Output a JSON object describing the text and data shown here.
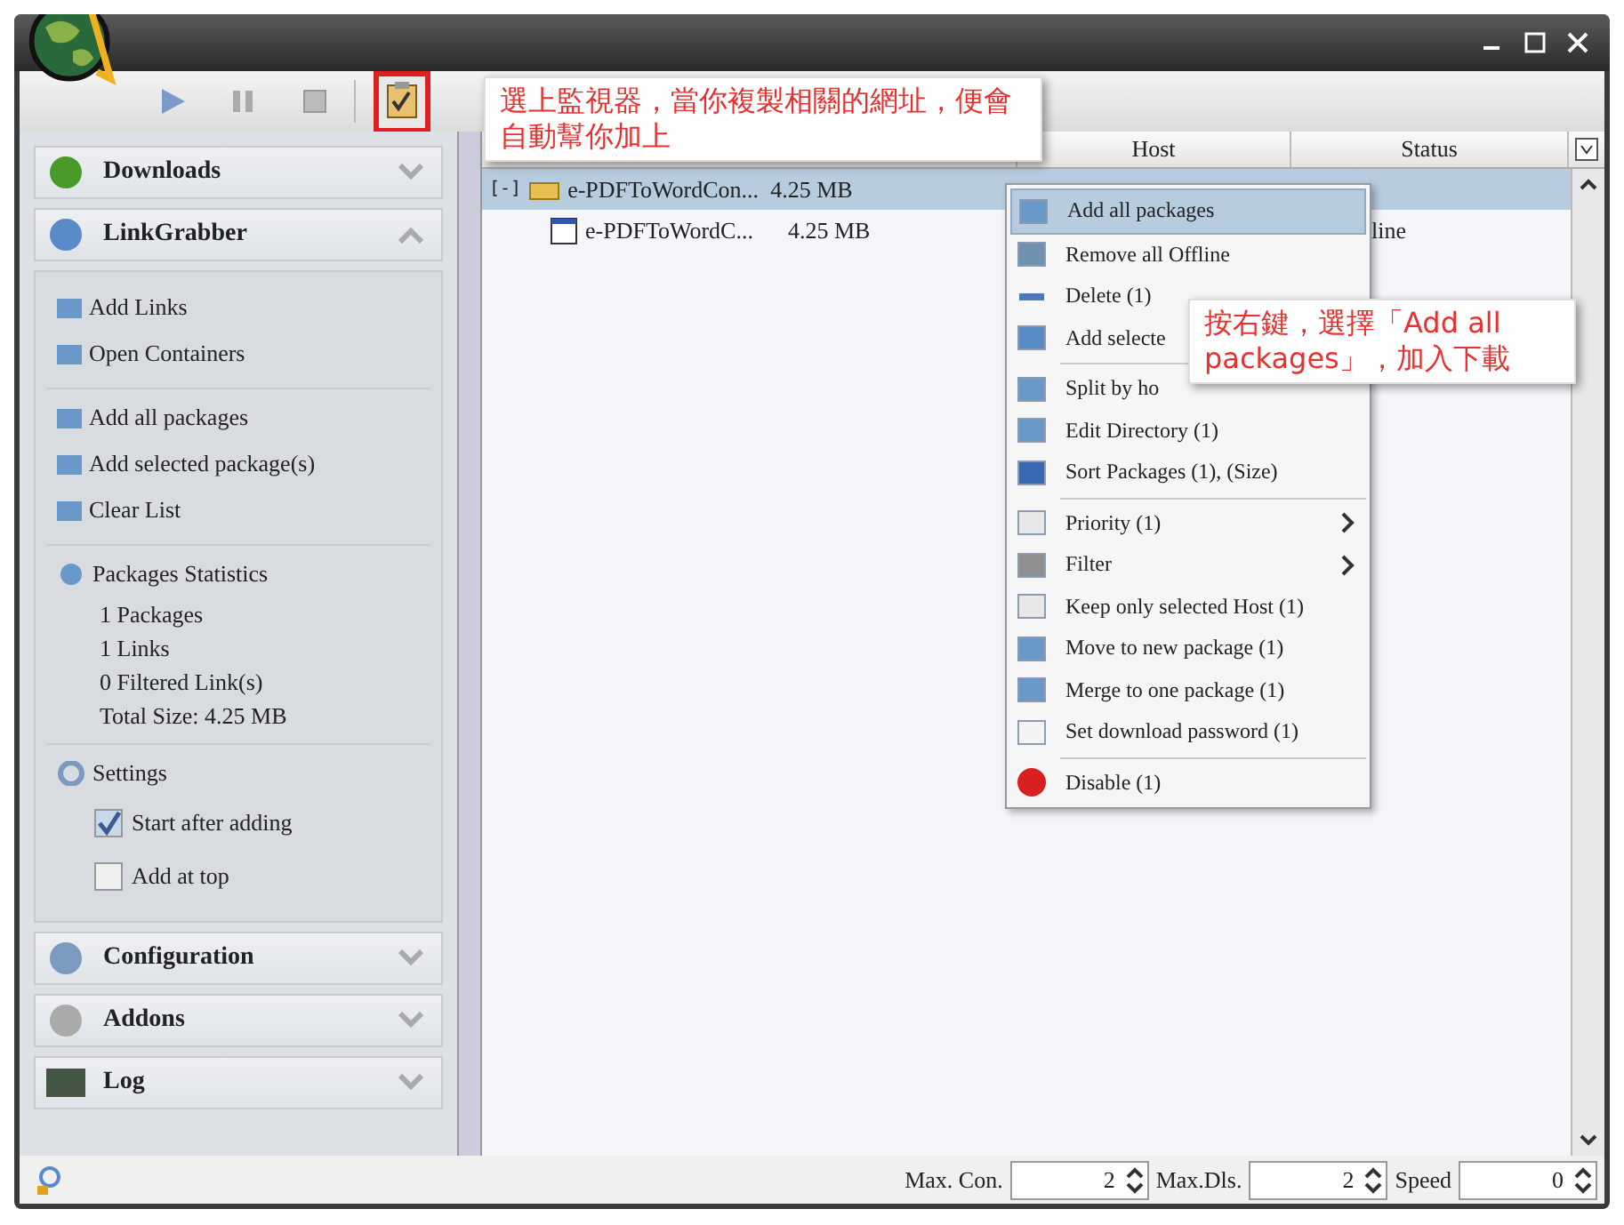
{
  "toolbar": {
    "clipboard_monitor": {
      "selected": true
    }
  },
  "sidebar": {
    "sections": [
      {
        "title": "Downloads",
        "expanded": false
      },
      {
        "title": "LinkGrabber",
        "expanded": true,
        "groups": [
          {
            "kind": "actions",
            "items": [
              {
                "label": "Add Links"
              },
              {
                "label": "Open Containers"
              }
            ]
          },
          {
            "kind": "actions",
            "items": [
              {
                "label": "Add all packages"
              },
              {
                "label": "Add selected package(s)"
              },
              {
                "label": "Clear List"
              }
            ]
          },
          {
            "kind": "stats",
            "title": "Packages Statistics",
            "lines": [
              "1 Packages",
              "1 Links",
              "0 Filtered Link(s)",
              "Total Size: 4.25 MB"
            ]
          },
          {
            "kind": "settings",
            "title": "Settings",
            "options": [
              {
                "label": "Start after adding",
                "checked": true
              },
              {
                "label": "Add at top",
                "checked": false
              }
            ]
          }
        ]
      },
      {
        "title": "Configuration",
        "expanded": false
      },
      {
        "title": "Addons",
        "expanded": false
      },
      {
        "title": "Log",
        "expanded": false
      }
    ]
  },
  "table": {
    "columns": [
      "Host",
      "Status"
    ],
    "rows": [
      {
        "kind": "package",
        "name": "e-PDFToWordCon...",
        "size": "4.25 MB",
        "selected": true,
        "expander": "[-]"
      },
      {
        "kind": "link",
        "name": "e-PDFToWordC...",
        "size": "4.25 MB",
        "status": "line",
        "selected": false
      }
    ]
  },
  "context_menu": {
    "items": [
      {
        "kind": "item",
        "label": "Add all packages",
        "highlighted": true,
        "submenu": false
      },
      {
        "kind": "item",
        "label": "Remove all Offline",
        "highlighted": false,
        "submenu": false
      },
      {
        "kind": "item",
        "label": "Delete (1)",
        "highlighted": false,
        "submenu": false
      },
      {
        "kind": "item",
        "label": "Add selecte",
        "highlighted": false,
        "submenu": false
      },
      {
        "kind": "separator"
      },
      {
        "kind": "item",
        "label": "Split by ho",
        "highlighted": false,
        "submenu": false
      },
      {
        "kind": "item",
        "label": "Edit Directory (1)",
        "highlighted": false,
        "submenu": false
      },
      {
        "kind": "item",
        "label": "Sort Packages (1), (Size)",
        "highlighted": false,
        "submenu": false
      },
      {
        "kind": "separator"
      },
      {
        "kind": "item",
        "label": "Priority (1)",
        "highlighted": false,
        "submenu": true
      },
      {
        "kind": "item",
        "label": "Filter",
        "highlighted": false,
        "submenu": true
      },
      {
        "kind": "item",
        "label": "Keep only selected Host (1)",
        "highlighted": false,
        "submenu": false
      },
      {
        "kind": "item",
        "label": "Move to new package (1)",
        "highlighted": false,
        "submenu": false
      },
      {
        "kind": "item",
        "label": "Merge to one package (1)",
        "highlighted": false,
        "submenu": false
      },
      {
        "kind": "item",
        "label": "Set download password (1)",
        "highlighted": false,
        "submenu": false
      },
      {
        "kind": "separator"
      },
      {
        "kind": "item",
        "label": "Disable (1)",
        "highlighted": false,
        "submenu": false
      }
    ]
  },
  "annotations": [
    {
      "text": "選上監視器，當你複製相關的網址，便會自動幫你加上"
    },
    {
      "text": "按右鍵，選擇「Add all packages」，加入下載"
    }
  ],
  "status_bar": {
    "fields": [
      {
        "label": "Max. Con.",
        "value": "2"
      },
      {
        "label": "Max.Dls.",
        "value": "2"
      },
      {
        "label": "Speed",
        "value": "0"
      }
    ]
  }
}
